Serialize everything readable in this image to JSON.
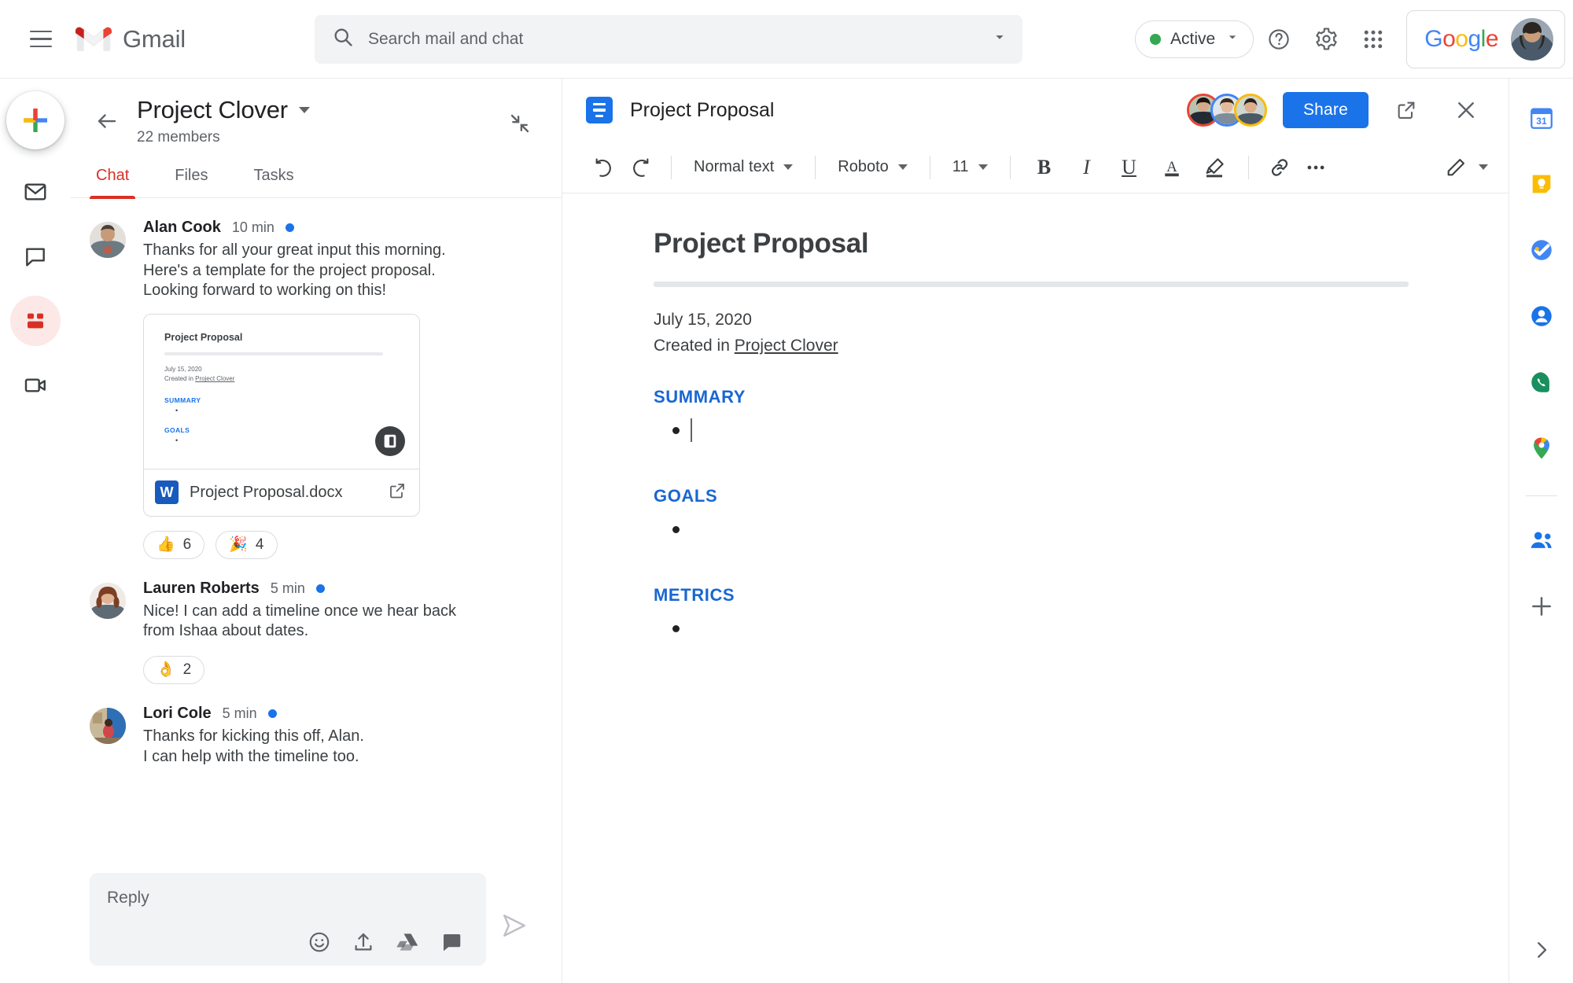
{
  "topbar": {
    "menu_icon": "hamburger-menu-icon",
    "brand": "Gmail",
    "search": {
      "placeholder": "Search mail and chat",
      "value": "",
      "icon": "search-icon",
      "options_icon": "chevron-down-icon"
    },
    "status": {
      "label": "Active",
      "color": "#34a853",
      "caret_icon": "chevron-down-icon"
    },
    "help_icon": "help-circle-icon",
    "settings_icon": "gear-icon",
    "apps_icon": "apps-grid-icon",
    "account": {
      "brand": "Google",
      "avatar": "user-avatar"
    }
  },
  "left_rail": {
    "compose_label": "compose-plus-icon",
    "items": [
      {
        "name": "mail-icon",
        "active": false
      },
      {
        "name": "chat-bubble-icon",
        "active": false
      },
      {
        "name": "rooms-people-icon",
        "active": true
      },
      {
        "name": "meet-video-icon",
        "active": false
      }
    ]
  },
  "chat": {
    "back_icon": "back-arrow-icon",
    "title": "Project Clover",
    "title_caret_icon": "chevron-down-icon",
    "members": "22 members",
    "collapse_icon": "collapse-diagonal-icon",
    "tabs": [
      {
        "label": "Chat",
        "active": true
      },
      {
        "label": "Files",
        "active": false
      },
      {
        "label": "Tasks",
        "active": false
      }
    ],
    "messages": [
      {
        "author": "Alan Cook",
        "time": "10 min",
        "unread": true,
        "lines": [
          "Thanks for all your great input this morning.",
          "Here's a template for the project proposal.",
          "Looking forward to working on this!"
        ],
        "attachment": {
          "preview_title": "Project Proposal",
          "preview_date": "July 15, 2020",
          "preview_created_prefix": "Created in ",
          "preview_created_link": "Project Clover",
          "preview_sections": [
            "SUMMARY",
            "GOALS"
          ],
          "filename": "Project Proposal.docx",
          "file_type_label": "W",
          "open_icon": "open-in-new-icon",
          "badge_icon": "doc-badge-icon"
        },
        "reactions": [
          {
            "emoji": "👍",
            "name": "thumbs-up-reaction",
            "count": "6"
          },
          {
            "emoji": "🎉",
            "name": "party-popper-reaction",
            "count": "4"
          }
        ]
      },
      {
        "author": "Lauren Roberts",
        "time": "5 min",
        "unread": true,
        "lines": [
          "Nice! I can add a timeline once we hear back",
          "from Ishaa about dates."
        ],
        "reactions": [
          {
            "emoji": "👌",
            "name": "ok-hand-reaction",
            "count": "2"
          }
        ]
      },
      {
        "author": "Lori Cole",
        "time": "5 min",
        "unread": true,
        "lines": [
          "Thanks for kicking this off, Alan.",
          "I can help with the timeline too."
        ],
        "reactions": []
      }
    ],
    "compose": {
      "placeholder": "Reply",
      "value": "",
      "tools": [
        "emoji-icon",
        "upload-icon",
        "google-drive-icon",
        "sticker-icon"
      ],
      "send_icon": "send-icon"
    }
  },
  "doc": {
    "header": {
      "icon": "google-docs-icon",
      "title": "Project Proposal",
      "collaborators": [
        "collaborator-avatar-1",
        "collaborator-avatar-2",
        "collaborator-avatar-3"
      ],
      "share_label": "Share",
      "popout_icon": "open-in-new-icon",
      "close_icon": "close-icon"
    },
    "toolbar": {
      "undo_icon": "undo-icon",
      "redo_icon": "redo-icon",
      "style": "Normal text",
      "font": "Roboto",
      "size": "11",
      "bold": "B",
      "italic": "I",
      "underline": "U",
      "text_color_icon": "text-color-icon",
      "highlight_icon": "highlight-icon",
      "link_icon": "insert-link-icon",
      "more_icon": "more-horizontal-icon",
      "edit_mode_icon": "pencil-edit-icon",
      "edit_mode_caret_icon": "chevron-down-icon"
    },
    "content": {
      "title": "Project Proposal",
      "date": "July 15, 2020",
      "created_prefix": "Created in ",
      "created_link": "Project Clover",
      "sections": [
        {
          "heading": "SUMMARY",
          "has_cursor": true
        },
        {
          "heading": "GOALS",
          "has_cursor": false
        },
        {
          "heading": "METRICS",
          "has_cursor": false
        }
      ]
    }
  },
  "right_rail": {
    "items": [
      "google-calendar-icon",
      "google-keep-icon",
      "google-tasks-icon",
      "google-contacts-icon",
      "google-voice-icon",
      "google-maps-icon"
    ],
    "people_icon": "people-icon",
    "add_icon": "add-plus-icon",
    "expand_icon": "chevron-right-icon"
  }
}
